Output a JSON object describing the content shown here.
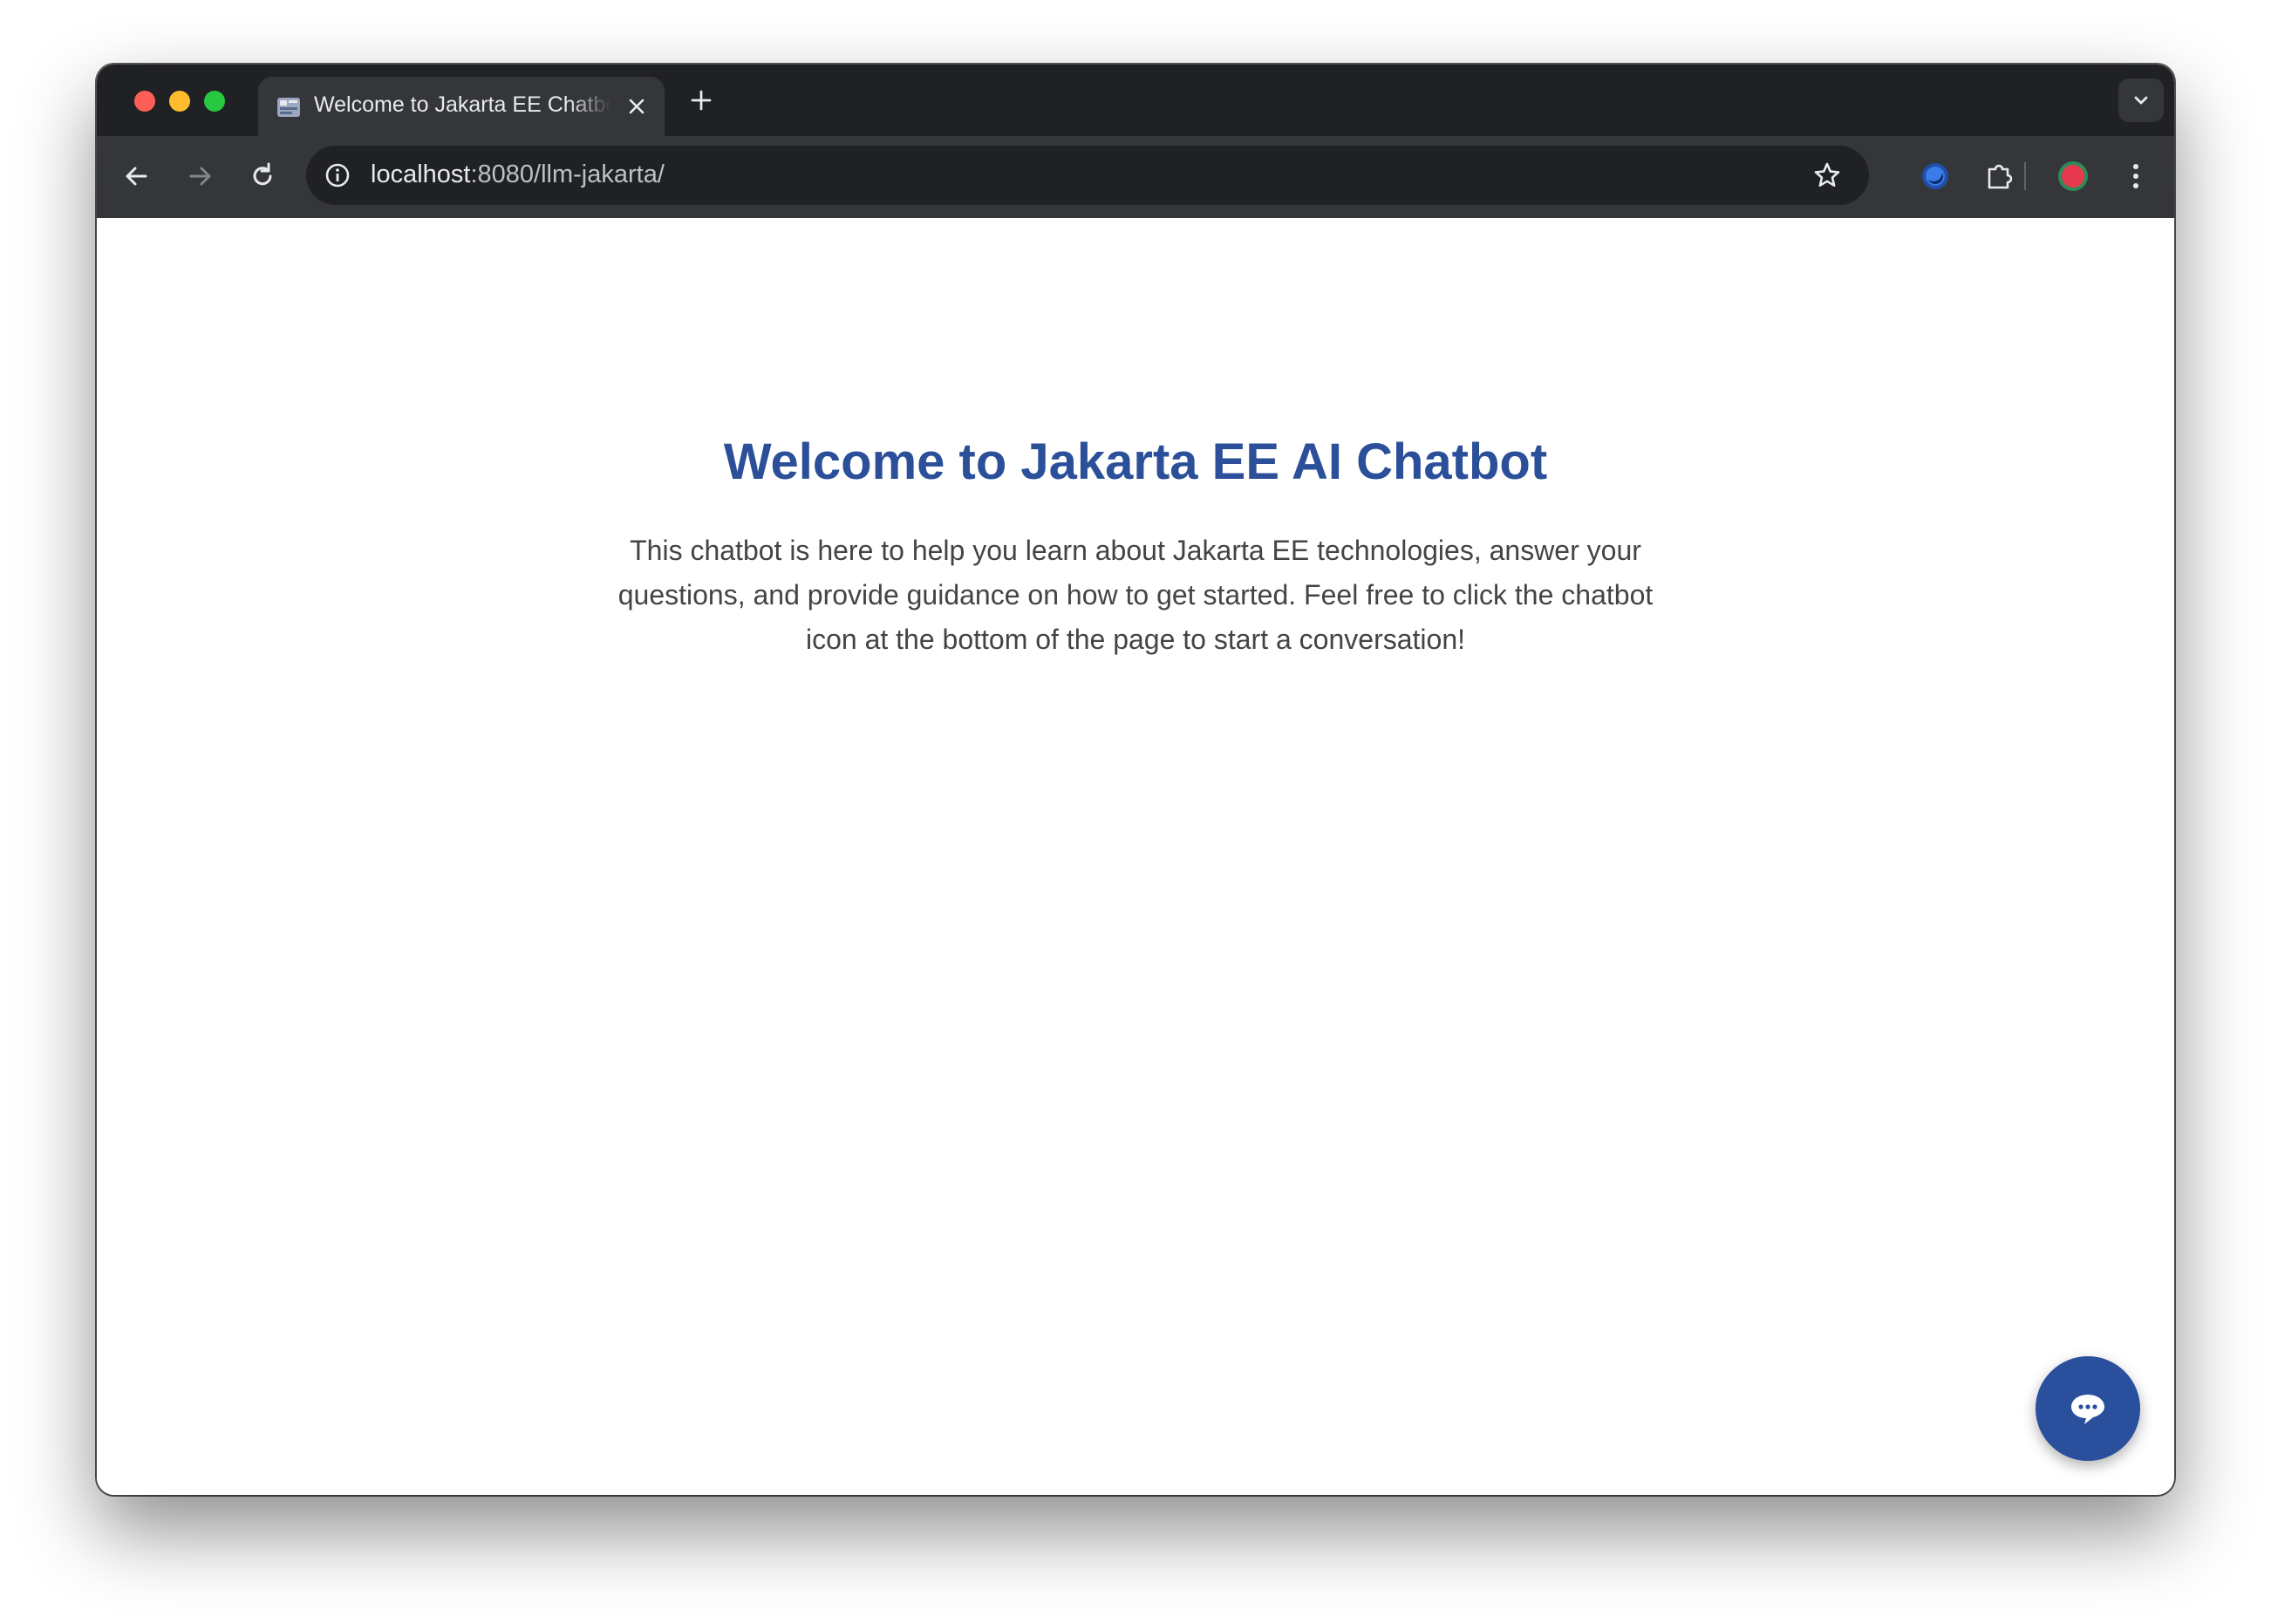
{
  "browser": {
    "tab": {
      "title": "Welcome to Jakarta EE Chatbot",
      "favicon": "jakarta-ee-favicon"
    },
    "address_bar": {
      "host": "localhost",
      "path": ":8080/llm-jakarta/"
    },
    "icons": {
      "back": "arrow-left-icon",
      "forward": "arrow-right-icon",
      "reload": "reload-icon",
      "site_info": "info-icon",
      "bookmark": "star-icon",
      "extension_1": "circle-extension-icon",
      "extensions": "puzzle-icon",
      "profile": "profile-avatar",
      "menu": "kebab-menu-icon",
      "tab_search": "chevron-down-icon",
      "new_tab": "plus-icon",
      "close_tab": "close-icon"
    }
  },
  "page": {
    "title": "Welcome to Jakarta EE AI Chatbot",
    "description": "This chatbot is here to help you learn about Jakarta EE technologies, answer your questions, and provide guidance on how to get started. Feel free to click the chatbot icon at the bottom of the page to start a conversation!",
    "chat_button_icon": "chat-bubble-icon"
  },
  "colors": {
    "title": "#2b4f99",
    "chat_button": "#2a4f9c",
    "text": "#444444"
  }
}
